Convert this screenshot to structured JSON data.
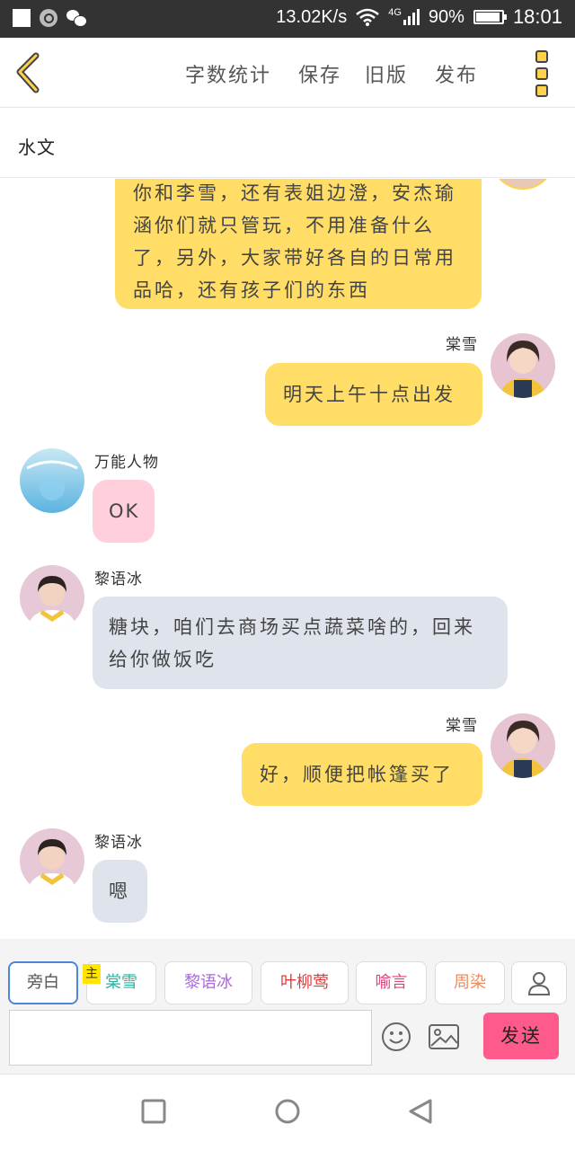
{
  "status_bar": {
    "speed": "13.02K/s",
    "net_label": "4G",
    "battery": "90%",
    "time": "18:01"
  },
  "toolbar": {
    "word_count": "字数统计",
    "save": "保存",
    "old_version": "旧版",
    "publish": "发布"
  },
  "story_title": "水文",
  "messages": [
    {
      "side": "right",
      "speaker": "",
      "text": "你和李雪，还有表姐边澄，安杰瑜涵你们就只管玩，不用准备什么了，另外，大家带好各自的日常用品哈，还有孩子们的东西",
      "color": "yellow"
    },
    {
      "side": "right",
      "speaker": "棠雪",
      "text": "明天上午十点出发",
      "color": "yellow"
    },
    {
      "side": "left",
      "speaker": "万能人物",
      "text": "OK",
      "color": "pink"
    },
    {
      "side": "left",
      "speaker": "黎语冰",
      "text": "糖块，咱们去商场买点蔬菜啥的，回来给你做饭吃",
      "color": "grey"
    },
    {
      "side": "right",
      "speaker": "棠雪",
      "text": "好，顺便把帐篷买了",
      "color": "yellow"
    },
    {
      "side": "left",
      "speaker": "黎语冰",
      "text": "嗯",
      "color": "grey"
    }
  ],
  "composer": {
    "roles": [
      {
        "label": "旁白",
        "color": "#555555"
      },
      {
        "label": "棠雪",
        "color": "#2bb5a0"
      },
      {
        "label": "黎语冰",
        "color": "#a96ad8"
      },
      {
        "label": "叶柳莺",
        "color": "#e23b3b"
      },
      {
        "label": "喻言",
        "color": "#e0407a"
      },
      {
        "label": "周染",
        "color": "#f08a5a"
      }
    ],
    "host_badge": "主",
    "input_value": "",
    "send_label": "发送"
  },
  "colors": {
    "accent_yellow": "#ffdd66",
    "send_pink": "#ff5a8c",
    "pink_bubble": "#ffd0dc",
    "grey_bubble": "#dfe3ec"
  }
}
